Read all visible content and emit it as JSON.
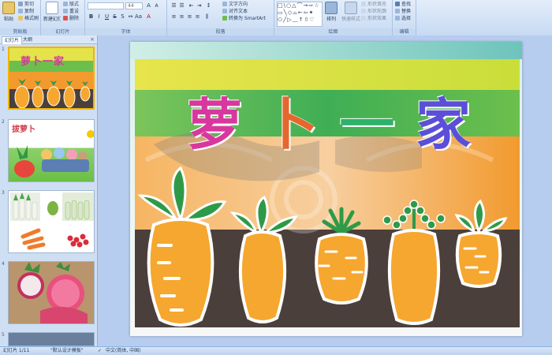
{
  "ribbon": {
    "clipboard": {
      "label": "剪贴板",
      "paste": "粘贴",
      "cut": "剪切",
      "copy": "复制",
      "format_painter": "格式刷"
    },
    "slides": {
      "label": "幻灯片",
      "new_slide": "新建幻灯片",
      "layout": "版式",
      "reset": "重设",
      "delete": "删除"
    },
    "font": {
      "label": "字体",
      "size": "44"
    },
    "paragraph": {
      "label": "段落",
      "text_direction": "文字方向",
      "align_text": "对齐文本",
      "smartart": "转换为 SmartArt"
    },
    "drawing": {
      "label": "绘图",
      "arrange": "排列",
      "quick_styles": "快速样式",
      "shape_fill": "形状填充",
      "shape_outline": "形状轮廓",
      "shape_effects": "形状效果"
    },
    "editing": {
      "label": "编辑",
      "find": "查找",
      "replace": "替换",
      "select": "选择"
    }
  },
  "panel": {
    "tabs": [
      "幻灯片",
      "大纲"
    ],
    "thumbnails": [
      {
        "number": "1",
        "title": "萝卜一家"
      },
      {
        "number": "2",
        "title": "拔萝卜"
      },
      {
        "number": "3",
        "title": ""
      },
      {
        "number": "4",
        "title": ""
      },
      {
        "number": "5",
        "title": ""
      }
    ]
  },
  "slide": {
    "title_chars": [
      "萝",
      "卜",
      "一",
      "家"
    ]
  },
  "status": {
    "slide_info": "幻灯片 1/11",
    "theme": "\"默认设计模板\"",
    "language": "中文(简体, 中国)"
  },
  "colors": {
    "band_yellow": "#e4e34a",
    "band_green": "#6cbf4c",
    "band_orange": "#f29a2e",
    "soil": "#4b3f3c",
    "carrot": "#f6a72f",
    "leaf": "#2e9a48",
    "ribbon_bg": "#dfeaf8",
    "selected_thumb": "#f0b400"
  }
}
